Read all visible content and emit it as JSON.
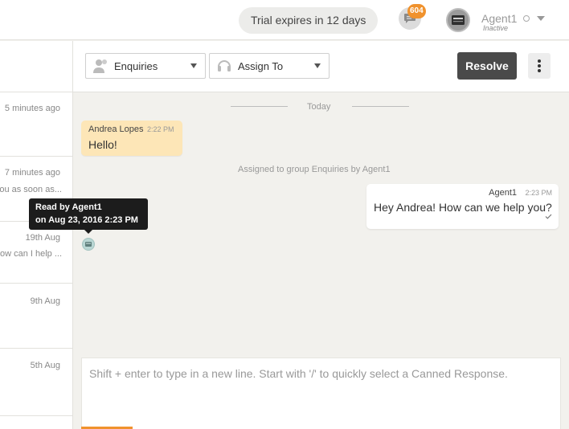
{
  "header": {
    "trial_text": "Trial expires in 12 days",
    "notification_count": "604",
    "agent_name": "Agent1",
    "agent_status": "Inactive"
  },
  "conversation_list": [
    {
      "time": "5 minutes ago",
      "preview": ""
    },
    {
      "time": "7 minutes ago",
      "preview": "ou as soon as..."
    },
    {
      "time": "19th Aug",
      "preview": "ow can I help ..."
    },
    {
      "time": "9th Aug",
      "preview": ""
    },
    {
      "time": "5th Aug",
      "preview": ""
    }
  ],
  "toolbar": {
    "group_select": "Enquiries",
    "assign_select": "Assign To",
    "resolve_label": "Resolve"
  },
  "messages": {
    "day_label": "Today",
    "incoming": {
      "sender": "Andrea Lopes",
      "time": "2:22 PM",
      "text": "Hello!"
    },
    "event": "Assigned to group Enquiries by Agent1",
    "outgoing": {
      "sender": "Agent1",
      "time": "2:23 PM",
      "text": "Hey Andrea! How can we help you?"
    },
    "read_tooltip": {
      "line1": "Read by Agent1",
      "line2": "on Aug 23, 2016 2:23 PM"
    }
  },
  "composer": {
    "placeholder": "Shift + enter to type in a new line. Start with '/' to quickly select a Canned Response."
  },
  "colors": {
    "accent": "#f0922d",
    "incoming_bubble": "#fde6b7",
    "resolve_button": "#4a4a4a"
  }
}
